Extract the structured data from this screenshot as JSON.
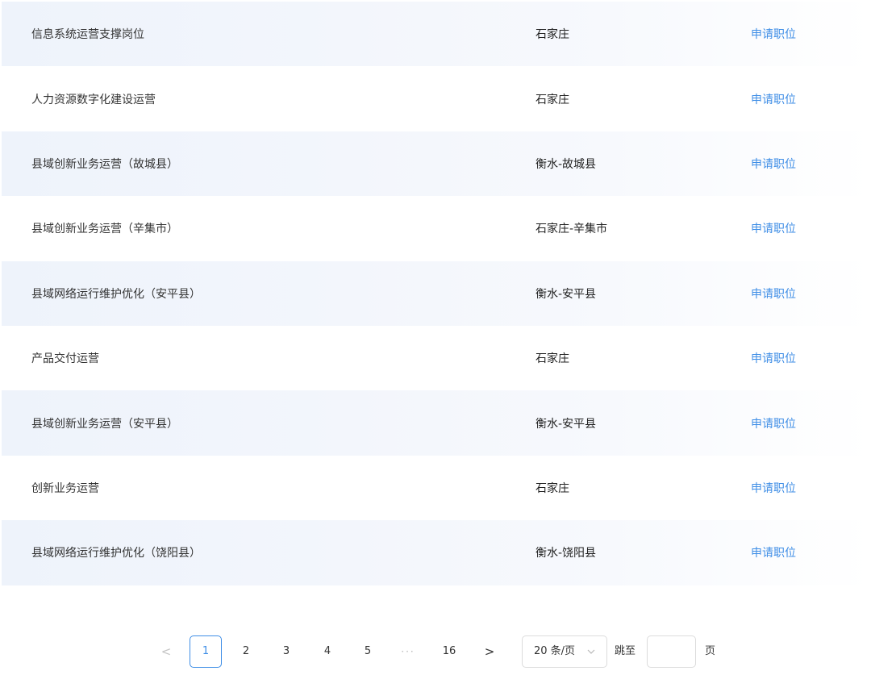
{
  "jobs": [
    {
      "title": "信息系统运营支撑岗位",
      "city": "石家庄",
      "apply_label": "申请职位"
    },
    {
      "title": "人力资源数字化建设运营",
      "city": "石家庄",
      "apply_label": "申请职位"
    },
    {
      "title": "县域创新业务运营（故城县）",
      "city": "衡水-故城县",
      "apply_label": "申请职位"
    },
    {
      "title": "县域创新业务运营（辛集市）",
      "city": "石家庄-辛集市",
      "apply_label": "申请职位"
    },
    {
      "title": "县域网络运行维护优化（安平县）",
      "city": "衡水-安平县",
      "apply_label": "申请职位"
    },
    {
      "title": "产品交付运营",
      "city": "石家庄",
      "apply_label": "申请职位"
    },
    {
      "title": "县域创新业务运营（安平县）",
      "city": "衡水-安平县",
      "apply_label": "申请职位"
    },
    {
      "title": "创新业务运营",
      "city": "石家庄",
      "apply_label": "申请职位"
    },
    {
      "title": "县域网络运行维护优化（饶阳县）",
      "city": "衡水-饶阳县",
      "apply_label": "申请职位"
    }
  ],
  "pagination": {
    "prev_label": "<",
    "current_page": "1",
    "pages": [
      "2",
      "3",
      "4",
      "5"
    ],
    "ellipsis": "···",
    "last_page": "16",
    "next_label": ">",
    "page_size": "20 条/页",
    "jump_label": "跳至",
    "jump_value": "",
    "jump_suffix": "页"
  },
  "colors": {
    "accent": "#3f8ee6",
    "row_shade": "#eef3fb",
    "text": "#333333"
  },
  "icons": {
    "page_size_arrow": "chevron-down-icon"
  }
}
